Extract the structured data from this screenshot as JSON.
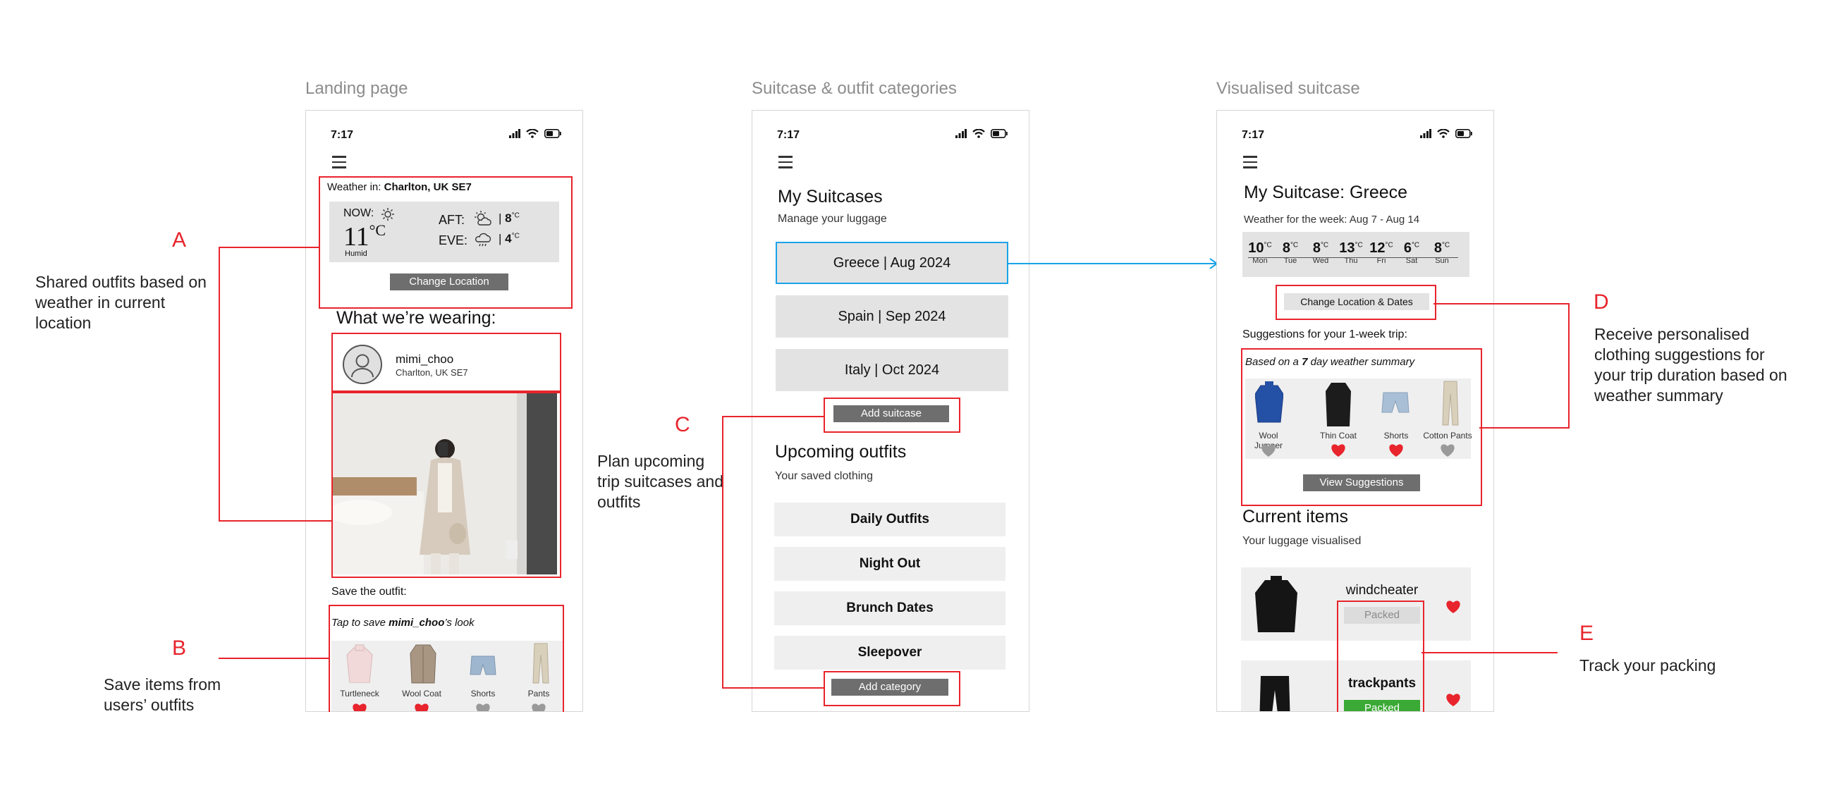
{
  "screens": {
    "landing_title": "Landing page",
    "suitcase_title": "Suitcase & outfit categories",
    "visualised_title": "Visualised suitcase"
  },
  "status_bar": {
    "time": "7:17"
  },
  "landing": {
    "weather_label": "Weather in:",
    "weather_location": "Charlton, UK SE7",
    "now_label": "NOW:",
    "now_temp": "11",
    "unit": "°C",
    "now_condition": "Humid",
    "aft_label": "AFT:",
    "aft_temp": "8",
    "eve_label": "EVE:",
    "eve_temp": "4",
    "unit_small": "°C",
    "change_location": "Change Location",
    "wearing_title": "What we’re wearing:",
    "user_name": "mimi_choo",
    "user_location": "Charlton, UK SE7",
    "save_outfit": "Save the outfit:",
    "tap_prefix": "Tap to save ",
    "tap_user": "mimi_choo",
    "tap_suffix": "’s look",
    "items": [
      {
        "label": "Turtleneck",
        "liked": true
      },
      {
        "label": "Wool Coat",
        "liked": true
      },
      {
        "label": "Shorts",
        "liked": false
      },
      {
        "label": "Pants",
        "liked": false
      }
    ]
  },
  "suitcases": {
    "title": "My Suitcases",
    "subtitle": "Manage your luggage",
    "list": [
      "Greece | Aug 2024",
      "Spain | Sep 2024",
      "Italy | Oct 2024"
    ],
    "add_suitcase": "Add suitcase",
    "outfits_title": "Upcoming outfits",
    "outfits_subtitle": "Your saved clothing",
    "categories": [
      "Daily Outfits",
      "Night Out",
      "Brunch Dates",
      "Sleepover"
    ],
    "add_category": "Add category"
  },
  "visualised": {
    "title": "My Suitcase: Greece",
    "weather_week": "Weather for the week: Aug 7 - Aug 14",
    "unit": "°C",
    "days": [
      {
        "temp": "10",
        "day": "Mon"
      },
      {
        "temp": "8",
        "day": "Tue"
      },
      {
        "temp": "8",
        "day": "Wed"
      },
      {
        "temp": "13",
        "day": "Thu"
      },
      {
        "temp": "12",
        "day": "Fri"
      },
      {
        "temp": "6",
        "day": "Sat"
      },
      {
        "temp": "8",
        "day": "Sun"
      }
    ],
    "change_btn": "Change Location & Dates",
    "suggestions_title": "Suggestions for your 1-week trip:",
    "based_prefix": "Based on a ",
    "based_num": "7",
    "based_suffix": " day weather summary",
    "suggestions": [
      {
        "label": "Wool Jumper",
        "liked": false
      },
      {
        "label": "Thin Coat",
        "liked": true
      },
      {
        "label": "Shorts",
        "liked": true
      },
      {
        "label": "Cotton Pants",
        "liked": false
      }
    ],
    "view_suggestions": "View Suggestions",
    "current_title": "Current items",
    "current_subtitle": "Your luggage visualised",
    "current_items": [
      {
        "name": "windcheater",
        "status": "Packed"
      },
      {
        "name": "trackpants",
        "status": "Packed"
      }
    ]
  },
  "annotations": {
    "a_letter": "A",
    "a_text": "Shared outfits based on weather in current location",
    "b_letter": "B",
    "b_text": "Save items from users’ outfits",
    "c_letter": "C",
    "c_text": "Plan upcoming trip suitcases and outfits",
    "d_letter": "D",
    "d_text": "Receive personalised clothing suggestions for your trip duration based on weather summary",
    "e_letter": "E",
    "e_text": "Track your packing"
  },
  "colors": {
    "accent_red": "#e8242c",
    "link_blue": "#1aa3e8",
    "packed_green": "#3aa935",
    "button_gray": "#6e6e6e",
    "heart_red": "#e8242c",
    "heart_gray": "#9a9a9a"
  }
}
